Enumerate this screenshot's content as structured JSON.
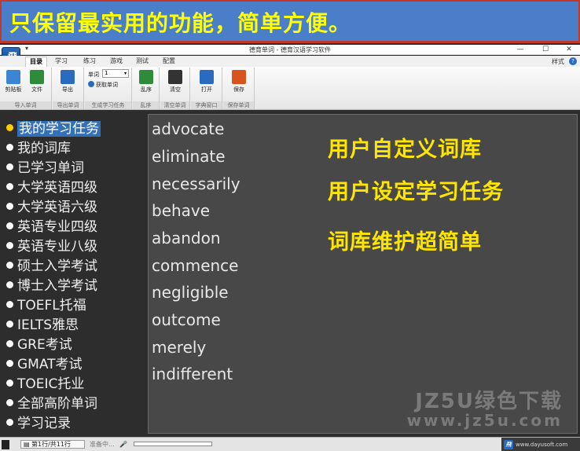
{
  "banner": {
    "text": "只保留最实用的功能，简单方便。"
  },
  "window": {
    "title": "德育单词 - 德育汉语学习软件",
    "quick_access": "▾",
    "app_icon_text": "飛",
    "controls": {
      "minimize": "—",
      "maximize": "☐",
      "close": "✕"
    }
  },
  "tabs": [
    {
      "label": "目录",
      "active": true
    },
    {
      "label": "学习"
    },
    {
      "label": "练习"
    },
    {
      "label": "游戏"
    },
    {
      "label": "测试"
    },
    {
      "label": "配置"
    }
  ],
  "style_menu": "样式",
  "help": "?",
  "ribbon": {
    "groups": [
      {
        "label": "导入单词"
      },
      {
        "label": "导出单词"
      },
      {
        "label": "生成学习任务"
      },
      {
        "label": "乱序"
      },
      {
        "label": "清空单词"
      },
      {
        "label": "字典窗口"
      },
      {
        "label": "保存单词"
      }
    ],
    "buttons": {
      "clipboard": "剪贴板",
      "file": "文件",
      "export": "导出",
      "shuffle": "乱序",
      "clear": "清空",
      "open": "打开",
      "save": "保存"
    },
    "word_select": {
      "label": "单词",
      "value": "1"
    },
    "fetch_words": "获取单词"
  },
  "icon_colors": {
    "clipboard": "#3a86d4",
    "file": "#2e8b3a",
    "export": "#2a6bbf",
    "shuffle": "#2e8b3a",
    "clear": "#333333",
    "open": "#2a6bbf",
    "save": "#d9531e"
  },
  "sidebar": {
    "items": [
      {
        "label": "我的学习任务",
        "selected": true
      },
      {
        "label": "我的词库"
      },
      {
        "label": "已学习单词"
      },
      {
        "label": "大学英语四级"
      },
      {
        "label": "大学英语六级"
      },
      {
        "label": "英语专业四级"
      },
      {
        "label": "英语专业八级"
      },
      {
        "label": "硕士入学考试"
      },
      {
        "label": "博士入学考试"
      },
      {
        "label": "TOEFL托福"
      },
      {
        "label": "IELTS雅思"
      },
      {
        "label": "GRE考试"
      },
      {
        "label": "GMAT考试"
      },
      {
        "label": "TOEIC托业"
      },
      {
        "label": "全部高阶单词"
      },
      {
        "label": "学习记录"
      }
    ]
  },
  "words": [
    "advocate",
    "eliminate",
    "necessarily",
    "behave",
    "abandon",
    "commence",
    "negligible",
    "outcome",
    "merely",
    "indifferent"
  ],
  "features": [
    "用户自定义词库",
    "用户设定学习任务",
    "词库维护超简单"
  ],
  "watermark": {
    "line1": "JZ5U绿色下载",
    "line2": "www.jz5u.com"
  },
  "status": {
    "position": "第1行/共11行",
    "state": "准备中...",
    "progress": 0.0,
    "tray_url": "www.dayusoft.com"
  }
}
